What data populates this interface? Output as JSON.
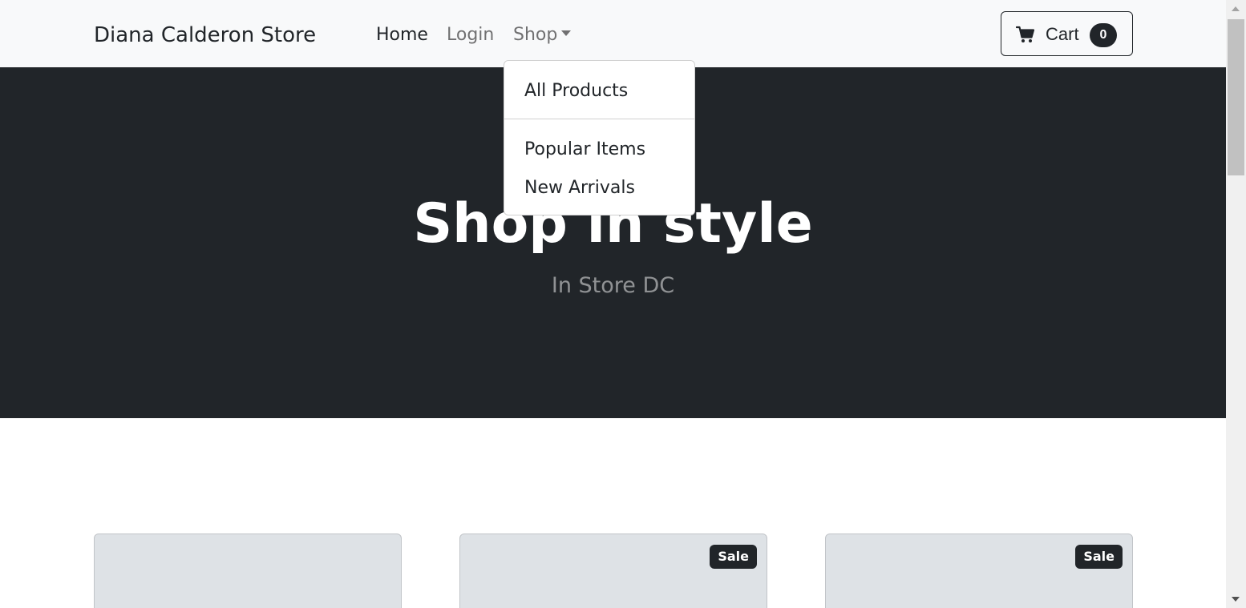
{
  "navbar": {
    "brand": "Diana Calderon Store",
    "links": [
      {
        "label": "Home",
        "active": true
      },
      {
        "label": "Login",
        "active": false
      },
      {
        "label": "Shop",
        "active": false
      }
    ],
    "cart": {
      "label": "Cart",
      "count": "0",
      "icon": "cart-icon"
    }
  },
  "dropdown": {
    "items": [
      "All Products",
      "Popular Items",
      "New Arrivals"
    ]
  },
  "hero": {
    "title": "Shop in style",
    "subtitle": "In Store DC"
  },
  "products": [
    {
      "badge": ""
    },
    {
      "badge": "Sale"
    },
    {
      "badge": "Sale"
    }
  ],
  "colors": {
    "navbar_bg": "#f8f9fa",
    "hero_bg": "#212529",
    "card_placeholder": "#dee2e6",
    "badge_bg": "#212529"
  }
}
